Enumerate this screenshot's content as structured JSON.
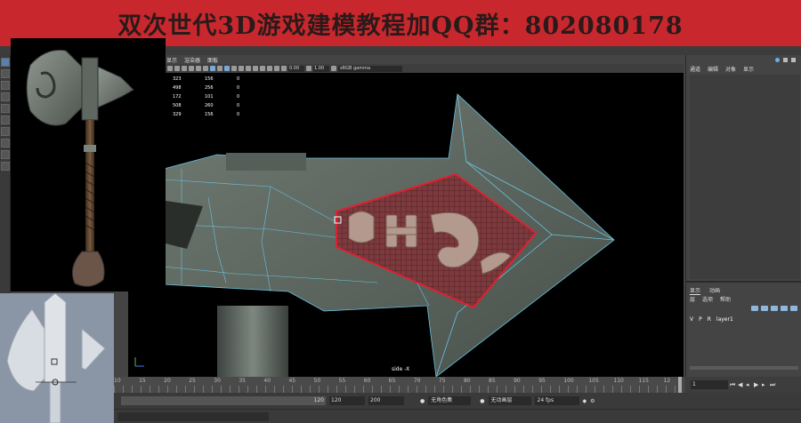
{
  "banner": {
    "text": "双次世代3D游戏建模教程加QQ群：802080178"
  },
  "viewport_menu": {
    "items": [
      "显示",
      "渲染器",
      "面板"
    ]
  },
  "viewport_toolbar": {
    "field_1": "0.00",
    "field_2": "1.00",
    "color_space": "sRGB gamma"
  },
  "stats": [
    [
      "323",
      "156",
      "0"
    ],
    [
      "498",
      "256",
      "0"
    ],
    [
      "172",
      "101",
      "0"
    ],
    [
      "508",
      "260",
      "0"
    ],
    [
      "329",
      "156",
      "0"
    ]
  ],
  "camera_label": "side -X",
  "right_panel": {
    "tabs": [
      "通道",
      "编辑",
      "对象",
      "显示"
    ],
    "layer_tabs": [
      "显示",
      "动画"
    ],
    "layer_menu": [
      "层",
      "选项",
      "帮助"
    ],
    "layer_row": {
      "v": "V",
      "p": "P",
      "r": "R",
      "name": "layer1"
    }
  },
  "timeline": {
    "ticks": [
      "10",
      "15",
      "20",
      "25",
      "30",
      "35",
      "40",
      "45",
      "50",
      "55",
      "60",
      "65",
      "70",
      "75",
      "80",
      "85",
      "90",
      "95",
      "100",
      "105",
      "110",
      "115",
      "12"
    ],
    "current_frame": "1"
  },
  "range": {
    "slider_value": "120",
    "end": "120",
    "max": "200",
    "char_set": "无角色集",
    "anim_layer": "无动画层",
    "fps": "24 fps"
  },
  "colors": {
    "banner": "#c8282d",
    "wireframe": "#6ac3e0",
    "selection": "#e02030"
  }
}
